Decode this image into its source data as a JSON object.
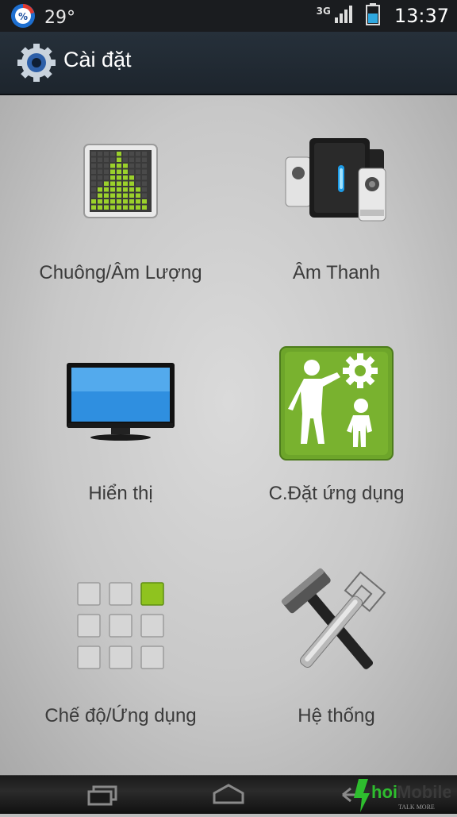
{
  "status": {
    "temperature": "29°",
    "network": "3G",
    "time": "13:37"
  },
  "header": {
    "title": "Cài đặt",
    "icon": "gear-icon"
  },
  "tiles": [
    {
      "label": "Chuông/Âm Lượng",
      "icon": "volume-equalizer-icon"
    },
    {
      "label": "Âm Thanh",
      "icon": "speakers-icon"
    },
    {
      "label": "Hiển thị",
      "icon": "monitor-icon"
    },
    {
      "label": "C.Đặt ứng dụng",
      "icon": "app-settings-icon"
    },
    {
      "label": "Chế độ/Ứng dụng",
      "icon": "app-grid-icon"
    },
    {
      "label": "Hệ thống",
      "icon": "tools-icon"
    }
  ],
  "navigation": {
    "recent_icon": "recent-apps-icon",
    "home_icon": "home-icon",
    "back_icon": "back-icon"
  },
  "watermark": {
    "brand": "hoi",
    "tagline": "TALK MORE"
  }
}
